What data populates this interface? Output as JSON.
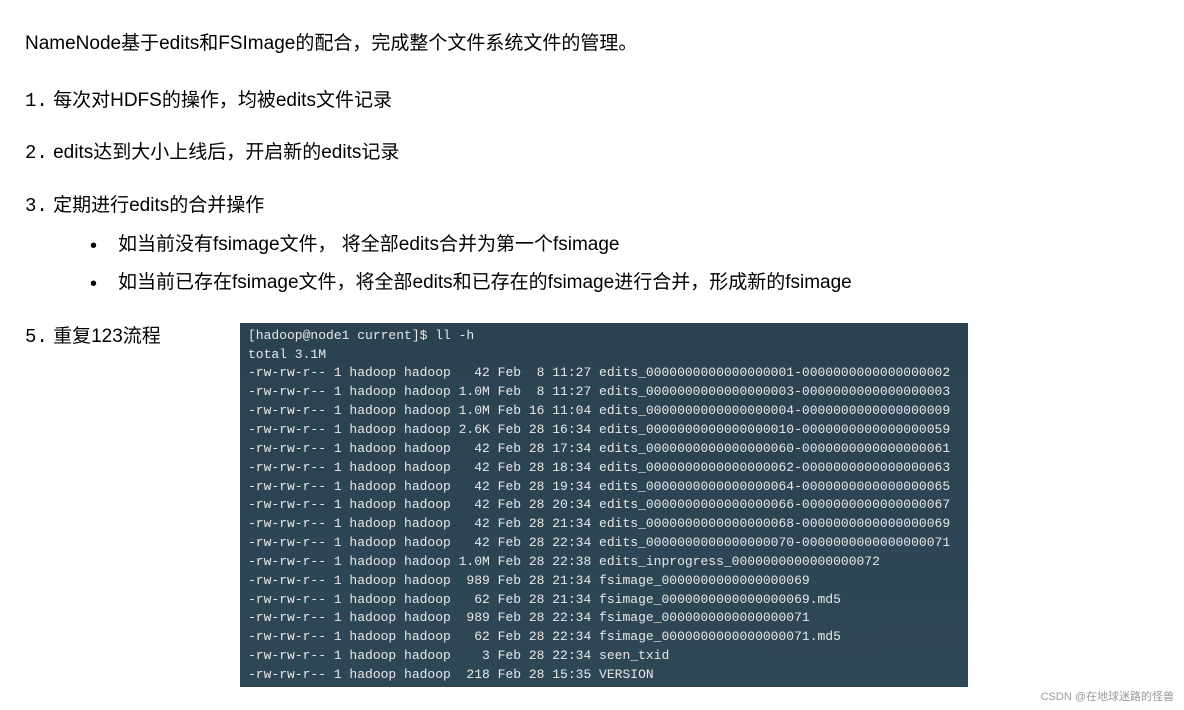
{
  "intro": "NameNode基于edits和FSImage的配合，完成整个文件系统文件的管理。",
  "items": [
    {
      "num": "1.",
      "text": "每次对HDFS的操作，均被edits文件记录"
    },
    {
      "num": "2.",
      "text": "edits达到大小上线后，开启新的edits记录"
    },
    {
      "num": "3.",
      "text": "定期进行edits的合并操作",
      "bullets": [
        "如当前没有fsimage文件，  将全部edits合并为第一个fsimage",
        "如当前已存在fsimage文件，将全部edits和已存在的fsimage进行合并，形成新的fsimage"
      ]
    }
  ],
  "last": {
    "num": "5.",
    "text": "重复123流程"
  },
  "terminal": {
    "prompt": "[hadoop@node1 current]$ ll -h",
    "lines": [
      "total 3.1M",
      "-rw-rw-r-- 1 hadoop hadoop   42 Feb  8 11:27 edits_0000000000000000001-0000000000000000002",
      "-rw-rw-r-- 1 hadoop hadoop 1.0M Feb  8 11:27 edits_0000000000000000003-0000000000000000003",
      "-rw-rw-r-- 1 hadoop hadoop 1.0M Feb 16 11:04 edits_0000000000000000004-0000000000000000009",
      "-rw-rw-r-- 1 hadoop hadoop 2.6K Feb 28 16:34 edits_0000000000000000010-0000000000000000059",
      "-rw-rw-r-- 1 hadoop hadoop   42 Feb 28 17:34 edits_0000000000000000060-0000000000000000061",
      "-rw-rw-r-- 1 hadoop hadoop   42 Feb 28 18:34 edits_0000000000000000062-0000000000000000063",
      "-rw-rw-r-- 1 hadoop hadoop   42 Feb 28 19:34 edits_0000000000000000064-0000000000000000065",
      "-rw-rw-r-- 1 hadoop hadoop   42 Feb 28 20:34 edits_0000000000000000066-0000000000000000067",
      "-rw-rw-r-- 1 hadoop hadoop   42 Feb 28 21:34 edits_0000000000000000068-0000000000000000069",
      "-rw-rw-r-- 1 hadoop hadoop   42 Feb 28 22:34 edits_0000000000000000070-0000000000000000071",
      "-rw-rw-r-- 1 hadoop hadoop 1.0M Feb 28 22:38 edits_inprogress_0000000000000000072",
      "-rw-rw-r-- 1 hadoop hadoop  989 Feb 28 21:34 fsimage_0000000000000000069",
      "-rw-rw-r-- 1 hadoop hadoop   62 Feb 28 21:34 fsimage_0000000000000000069.md5",
      "-rw-rw-r-- 1 hadoop hadoop  989 Feb 28 22:34 fsimage_0000000000000000071",
      "-rw-rw-r-- 1 hadoop hadoop   62 Feb 28 22:34 fsimage_0000000000000000071.md5",
      "-rw-rw-r-- 1 hadoop hadoop    3 Feb 28 22:34 seen_txid",
      "-rw-rw-r-- 1 hadoop hadoop  218 Feb 28 15:35 VERSION"
    ]
  },
  "watermark": "CSDN @在地球迷路的怪兽"
}
